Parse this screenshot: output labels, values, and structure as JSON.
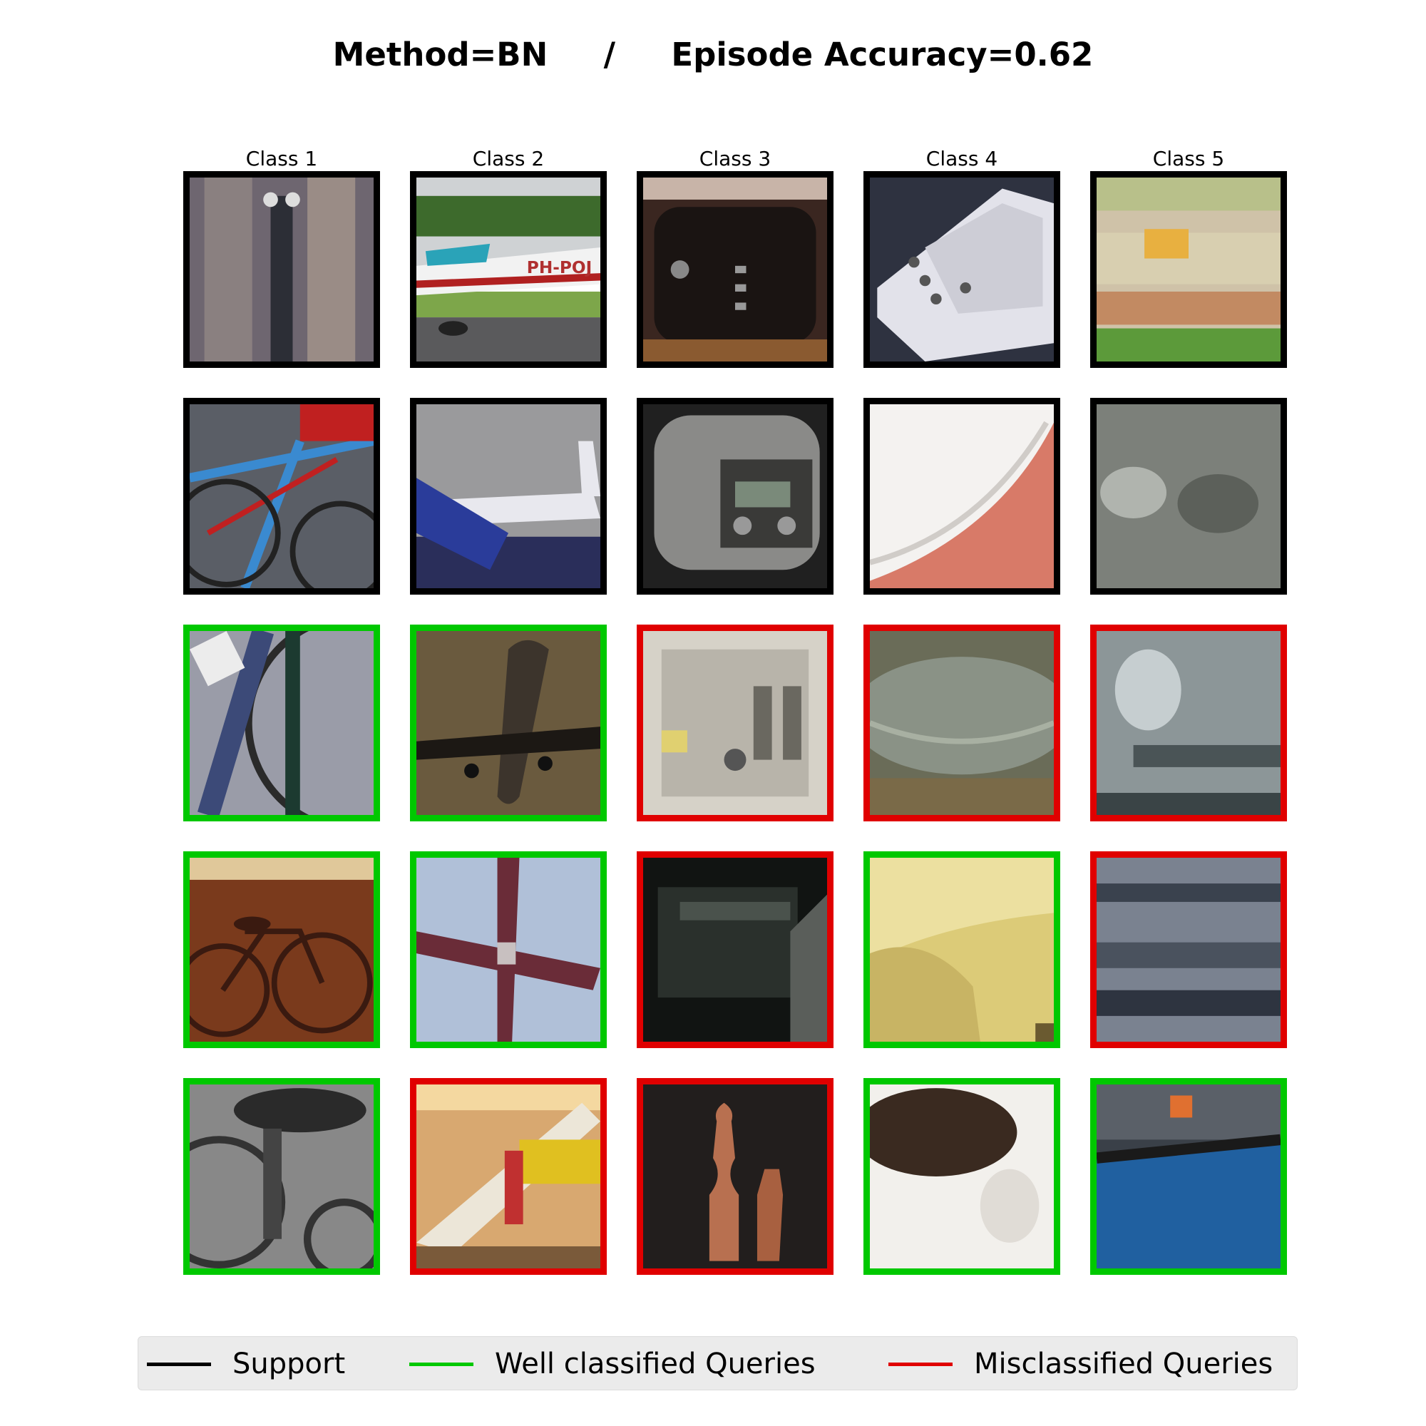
{
  "title": {
    "method": "Method=BN",
    "separator": "/",
    "accuracy": "Episode Accuracy=0.62"
  },
  "colors": {
    "support": "#000000",
    "correct": "#00c800",
    "incorrect": "#e00000"
  },
  "class_labels": [
    "Class 1",
    "Class 2",
    "Class 3",
    "Class 4",
    "Class 5"
  ],
  "grid": {
    "rows": [
      {
        "role": "support",
        "cells": [
          {
            "status": "support",
            "subject": "bicycle"
          },
          {
            "status": "support",
            "subject": "airplane"
          },
          {
            "status": "support",
            "subject": "toaster"
          },
          {
            "status": "support",
            "subject": "sink"
          },
          {
            "status": "support",
            "subject": "blurry scene"
          }
        ]
      },
      {
        "role": "support",
        "cells": [
          {
            "status": "support",
            "subject": "bicycles"
          },
          {
            "status": "support",
            "subject": "airliner"
          },
          {
            "status": "support",
            "subject": "rice cooker"
          },
          {
            "status": "support",
            "subject": "sink"
          },
          {
            "status": "support",
            "subject": "blurry scene"
          }
        ]
      },
      {
        "role": "query",
        "cells": [
          {
            "status": "correct",
            "subject": "bicycle wheel"
          },
          {
            "status": "correct",
            "subject": "airplane landing"
          },
          {
            "status": "incorrect",
            "subject": "toaster"
          },
          {
            "status": "incorrect",
            "subject": "glass bowl"
          },
          {
            "status": "incorrect",
            "subject": "blurry scene"
          }
        ]
      },
      {
        "role": "query",
        "cells": [
          {
            "status": "correct",
            "subject": "bicycle"
          },
          {
            "status": "correct",
            "subject": "airplane"
          },
          {
            "status": "incorrect",
            "subject": "toaster"
          },
          {
            "status": "correct",
            "subject": "sink"
          },
          {
            "status": "incorrect",
            "subject": "blurry scene"
          }
        ]
      },
      {
        "role": "query",
        "cells": [
          {
            "status": "correct",
            "subject": "bicycle saddle"
          },
          {
            "status": "incorrect",
            "subject": "airplane in museum"
          },
          {
            "status": "incorrect",
            "subject": "pepper mills"
          },
          {
            "status": "correct",
            "subject": "blurry sink"
          },
          {
            "status": "correct",
            "subject": "blurry scene"
          }
        ]
      }
    ]
  },
  "legend": {
    "support_label": "Support",
    "correct_label": "Well classified Queries",
    "incorrect_label": "Misclassified Queries"
  }
}
